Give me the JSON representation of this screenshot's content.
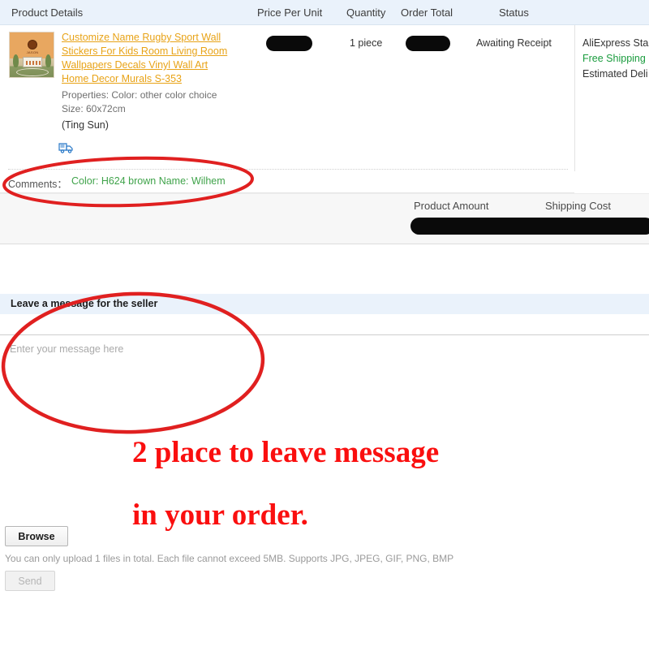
{
  "order_table": {
    "columns": [
      {
        "key": "product_details",
        "label": "Product Details"
      },
      {
        "key": "price_per_unit",
        "label": "Price Per Unit"
      },
      {
        "key": "quantity",
        "label": "Quantity"
      },
      {
        "key": "order_total",
        "label": "Order Total"
      },
      {
        "key": "status",
        "label": "Status"
      }
    ],
    "row": {
      "product_title_lines": [
        "Customize Name Rugby Sport Wall",
        "Stickers For Kids Room Living Room",
        "Wallpapers Decals Vinyl Wall Art",
        "Home Decor Murals S-353"
      ],
      "properties": "Properties: Color: other color choice",
      "size": "Size: 60x72cm",
      "buyer": "(Ting Sun)",
      "shipping_icon": "truck-icon",
      "price_per_unit": "",
      "price_per_unit_redacted": true,
      "quantity": "1 piece",
      "order_total": "",
      "order_total_redacted": true,
      "status": "Awaiting Receipt",
      "shipping_lines": [
        "AliExpress Sta",
        "Free Shipping",
        "Estimated Deli"
      ]
    },
    "comments": {
      "label": "Comments：",
      "value": "Color: H624 brown Name: Wilhem",
      "value_color": "#3fa34a"
    },
    "summary": {
      "product_amount_label": "Product Amount",
      "shipping_cost_label": "Shipping Cost",
      "amount_redacted": true
    }
  },
  "message_panel": {
    "title": "Leave a message for the seller",
    "textarea_value": "",
    "textarea_placeholder": "Enter your message here",
    "browse_label": "Browse",
    "upload_hint": "You can only upload 1 files in total. Each file cannot exceed 5MB. Supports JPG, JPEG, GIF, PNG, BMP",
    "send_label": "Send"
  },
  "annotations": {
    "line1": "2 place to leave message",
    "line2": "in your order.",
    "color": "#fa0f0f",
    "ellipse_count": 2
  }
}
